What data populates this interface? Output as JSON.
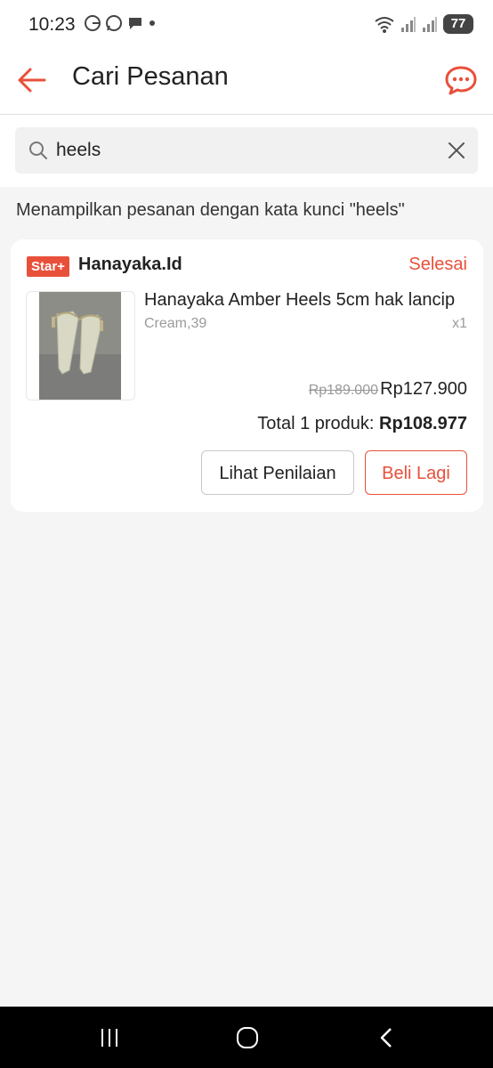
{
  "status_bar": {
    "time": "10:23",
    "battery": "77"
  },
  "header": {
    "title": "Cari Pesanan"
  },
  "search": {
    "value": "heels"
  },
  "results": {
    "summary": "Menampilkan pesanan dengan kata kunci \"heels\""
  },
  "order": {
    "badge": "Star+",
    "shop_name": "Hanayaka.Id",
    "status": "Selesai",
    "product_name": "Hanayaka Amber Heels 5cm hak lancip",
    "variant": "Cream,39",
    "quantity": "x1",
    "price_original": "Rp189.000",
    "price_current": "Rp127.900",
    "total_label": "Total 1 produk:",
    "total_amount": "Rp108.977",
    "review_label": "Lihat Penilaian",
    "rebuy_label": "Beli Lagi"
  },
  "colors": {
    "accent": "#e8503a",
    "background": "#f5f5f5"
  }
}
